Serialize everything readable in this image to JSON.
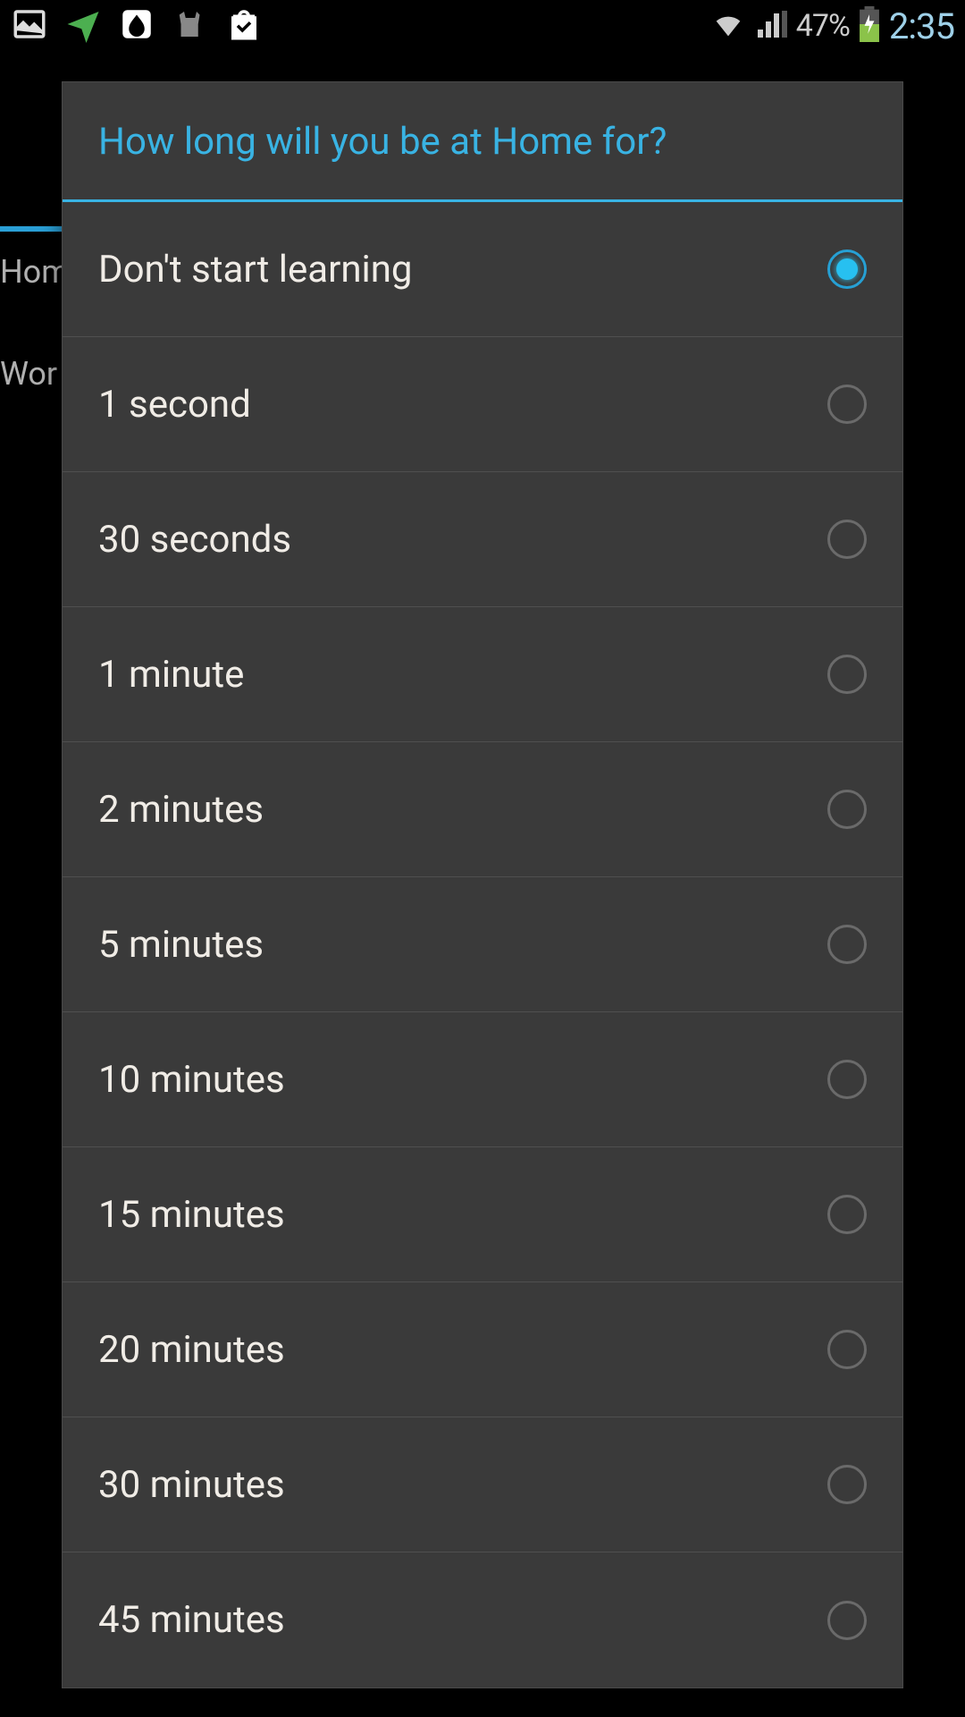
{
  "status_bar": {
    "battery_pct": "47%",
    "time": "2:35"
  },
  "background": {
    "tab_home": "Hom",
    "tab_work": "Wor"
  },
  "dialog": {
    "title": "How long will you be at Home for?",
    "options": [
      {
        "label": "Don't start learning",
        "selected": true
      },
      {
        "label": "1 second",
        "selected": false
      },
      {
        "label": "30 seconds",
        "selected": false
      },
      {
        "label": "1 minute",
        "selected": false
      },
      {
        "label": "2 minutes",
        "selected": false
      },
      {
        "label": "5 minutes",
        "selected": false
      },
      {
        "label": "10 minutes",
        "selected": false
      },
      {
        "label": "15 minutes",
        "selected": false
      },
      {
        "label": "20 minutes",
        "selected": false
      },
      {
        "label": "30 minutes",
        "selected": false
      },
      {
        "label": "45 minutes",
        "selected": false
      }
    ]
  }
}
